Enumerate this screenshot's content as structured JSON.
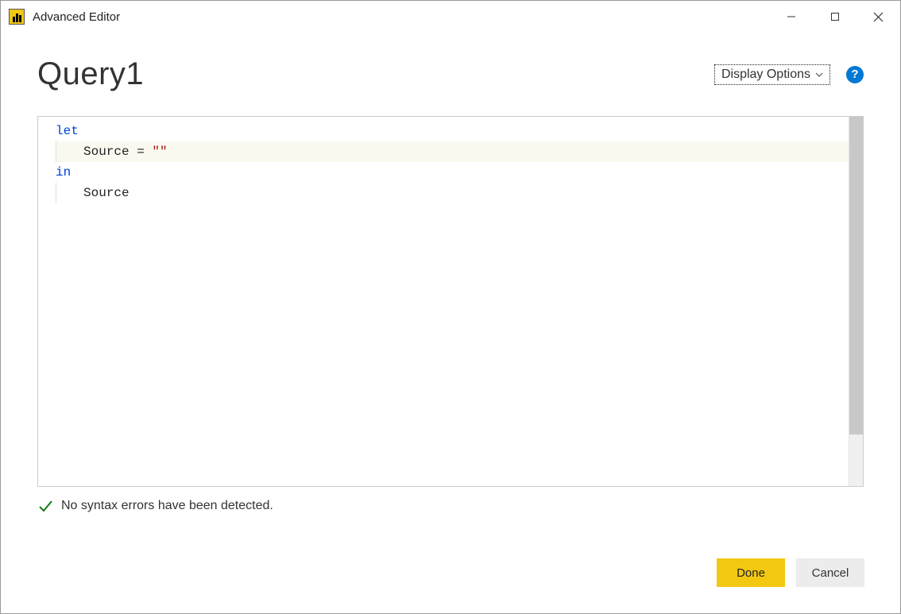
{
  "titlebar": {
    "title": "Advanced Editor"
  },
  "header": {
    "page_title": "Query1",
    "display_options_label": "Display Options"
  },
  "editor": {
    "lines": {
      "l1_kw": "let",
      "l2_ident": "Source = ",
      "l2_str": "\"\"",
      "l3_kw": "in",
      "l4_ident": "Source"
    }
  },
  "status": {
    "message": "No syntax errors have been detected."
  },
  "footer": {
    "done_label": "Done",
    "cancel_label": "Cancel"
  }
}
